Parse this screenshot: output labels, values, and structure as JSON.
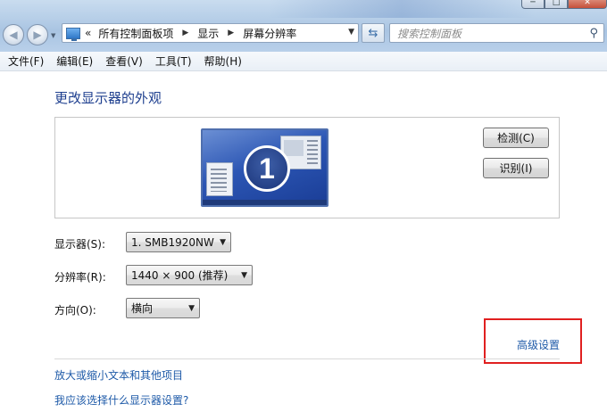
{
  "window": {
    "controls": {
      "minimize": "─",
      "maximize": "□",
      "close": "✕"
    }
  },
  "nav": {
    "back_icon": "back-arrow-icon",
    "forward_icon": "forward-arrow-icon",
    "address": {
      "lead": "«",
      "crumbs": [
        "所有控制面板项",
        "显示",
        "屏幕分辨率"
      ]
    },
    "search": {
      "placeholder": "搜索控制面板"
    }
  },
  "menu": {
    "items": [
      "文件(F)",
      "编辑(E)",
      "查看(V)",
      "工具(T)",
      "帮助(H)"
    ]
  },
  "main": {
    "title": "更改显示器的外观",
    "monitor_number": "1",
    "detect_label": "检测(C)",
    "identify_label": "识别(I)",
    "fields": {
      "display": {
        "label": "显示器(S):",
        "value": "1. SMB1920NW"
      },
      "resolution": {
        "label": "分辨率(R):",
        "value": "1440 × 900 (推荐)"
      },
      "orientation": {
        "label": "方向(O):",
        "value": "横向"
      }
    },
    "advanced_link": "高级设置",
    "links": [
      "放大或缩小文本和其他项目",
      "我应该选择什么显示器设置?"
    ]
  },
  "colors": {
    "link": "#1e5aa8",
    "title": "#1e3f8f",
    "highlight": "#e02020"
  }
}
